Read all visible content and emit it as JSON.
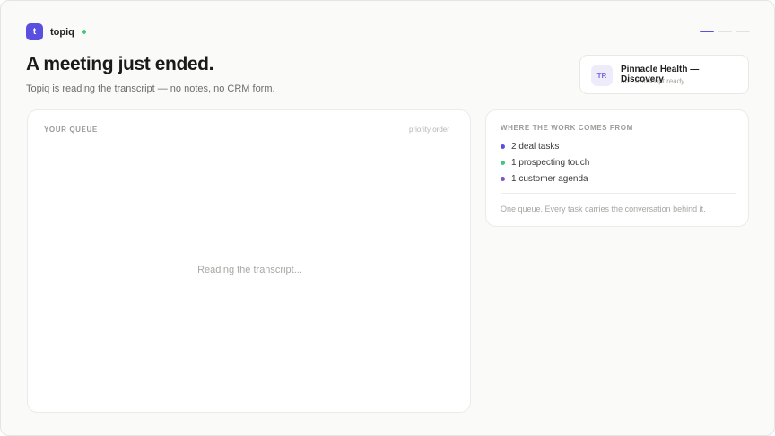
{
  "app": {
    "logo_letter": "t",
    "name": "topiq",
    "status_color": "#3ec97a",
    "accent_color": "#5b4fe0"
  },
  "progress": {
    "total_steps": 3,
    "current_step": 1
  },
  "hero": {
    "title": "A meeting just ended.",
    "subtitle": "Topiq is reading the transcript — no notes, no CRM form."
  },
  "meeting": {
    "avatar_initials": "TR",
    "name": "Pinnacle Health — Discovery",
    "meta": "· transcript ready",
    "meta_partial": "an"
  },
  "queue": {
    "title": "YOUR QUEUE",
    "order_label": "priority order",
    "empty_text": "Reading the transcript..."
  },
  "sources": {
    "title": "WHERE THE WORK COMES FROM",
    "items": [
      {
        "label": "2 deal tasks",
        "color": "#5b4fe0"
      },
      {
        "label": "1 prospecting touch",
        "color": "#3ec97a"
      },
      {
        "label": "1 customer agenda",
        "color": "#7a52c9"
      }
    ],
    "footer": "One queue. Every task carries the conversation behind it."
  }
}
